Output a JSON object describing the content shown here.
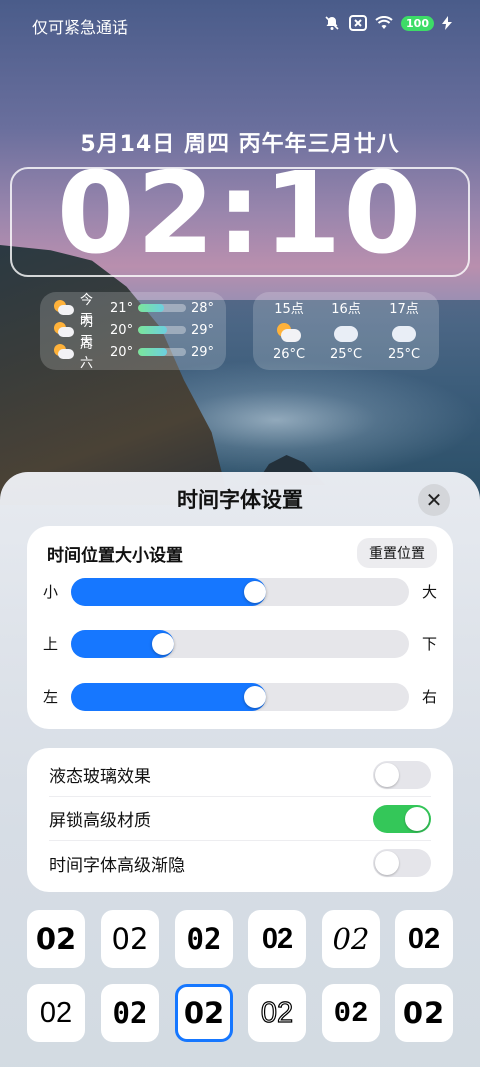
{
  "status_bar": {
    "left_text": "仅可紧急通话",
    "battery": "100",
    "icons": [
      "mute-bell-icon",
      "no-sim-icon",
      "wifi-icon",
      "battery-icon",
      "charging-icon"
    ]
  },
  "lockscreen": {
    "date": "5月14日 周四 丙午年三月廿八",
    "time": "02:10"
  },
  "weather_daily": [
    {
      "day": "今天",
      "low": "21°",
      "high": "28°",
      "bar_start": 0.0,
      "bar_end": 0.55
    },
    {
      "day": "明天",
      "low": "20°",
      "high": "29°",
      "bar_start": 0.0,
      "bar_end": 0.6
    },
    {
      "day": "周六",
      "low": "20°",
      "high": "29°",
      "bar_start": 0.0,
      "bar_end": 0.6
    }
  ],
  "weather_hourly": [
    {
      "hour": "15点",
      "temp": "26°C",
      "icon": "sun-cloud-icon"
    },
    {
      "hour": "16点",
      "temp": "25°C",
      "icon": "cloud-icon"
    },
    {
      "hour": "17点",
      "temp": "25°C",
      "icon": "cloud-icon"
    }
  ],
  "sheet": {
    "title": "时间字体设置",
    "close_icon": "close-icon",
    "position_card": {
      "title": "时间位置大小设置",
      "reset_label": "重置位置",
      "sliders": [
        {
          "left": "小",
          "right": "大",
          "value": 0.54
        },
        {
          "left": "上",
          "right": "下",
          "value": 0.27
        },
        {
          "left": "左",
          "right": "右",
          "value": 0.54
        }
      ]
    },
    "toggles": [
      {
        "label": "液态玻璃效果",
        "on": false
      },
      {
        "label": "屏锁高级材质",
        "on": true
      },
      {
        "label": "时间字体高级渐隐",
        "on": false
      }
    ],
    "font_samples": [
      "02",
      "02",
      "02",
      "02",
      "02",
      "02",
      "02",
      "02",
      "02",
      "02",
      "02",
      "02"
    ],
    "selected_font_index": 8
  },
  "colors": {
    "accent": "#1677ff",
    "toggle_on": "#34c759"
  }
}
